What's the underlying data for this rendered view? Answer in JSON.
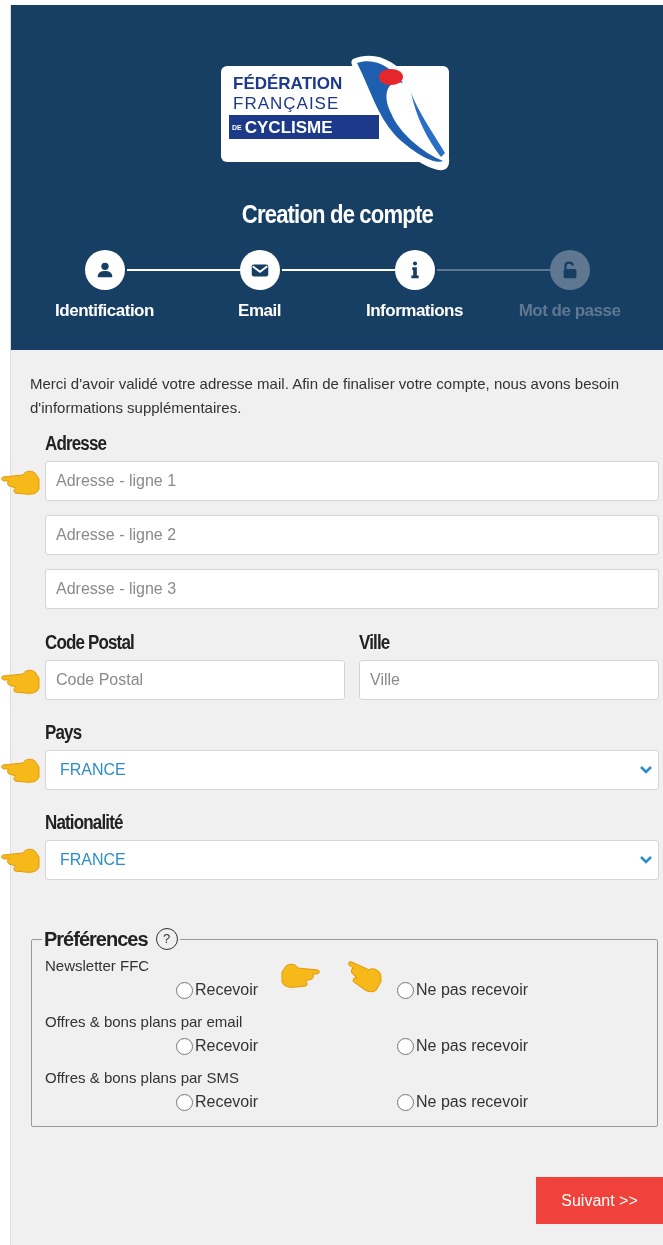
{
  "logo": {
    "line_1": "FÉDÉRATION",
    "line_2": "FRANÇAISE",
    "line_3_prefix": "DE",
    "line_3": "CYCLISME"
  },
  "title": "Creation de compte",
  "steps": [
    {
      "label": "Identification",
      "active": true
    },
    {
      "label": "Email",
      "active": true
    },
    {
      "label": "Informations",
      "active": true
    },
    {
      "label": "Mot de passe",
      "active": false
    }
  ],
  "intro": "Merci d'avoir validé votre adresse mail. Afin de finaliser votre compte, nous avons besoin d'informations supplémentaires.",
  "address": {
    "label": "Adresse",
    "fields": [
      {
        "placeholder": "Adresse - ligne 1",
        "pointer": true
      },
      {
        "placeholder": "Adresse - ligne 2",
        "pointer": false
      },
      {
        "placeholder": "Adresse - ligne 3",
        "pointer": false
      }
    ]
  },
  "postal_code": {
    "label": "Code Postal",
    "placeholder": "Code Postal",
    "pointer": true
  },
  "city": {
    "label": "Ville",
    "placeholder": "Ville"
  },
  "selects": [
    {
      "label": "Pays",
      "value": "FRANCE",
      "pointer": true
    },
    {
      "label": "Nationalité",
      "value": "FRANCE",
      "pointer": true
    }
  ],
  "preferences": {
    "legend": "Préférences",
    "help": "?",
    "items": [
      {
        "label": "Newsletter FFC",
        "options": [
          {
            "label": "Recevoir",
            "selected": false
          },
          {
            "label": "Ne pas recevoir",
            "selected": false
          }
        ]
      },
      {
        "label": "Offres & bons plans par email",
        "options": [
          {
            "label": "Recevoir",
            "selected": false
          },
          {
            "label": "Ne pas recevoir",
            "selected": false
          }
        ]
      },
      {
        "label": "Offres & bons plans par SMS",
        "options": [
          {
            "label": "Recevoir",
            "selected": false
          },
          {
            "label": "Ne pas recevoir",
            "selected": false
          }
        ]
      }
    ]
  },
  "next_button": "Suivant >>"
}
